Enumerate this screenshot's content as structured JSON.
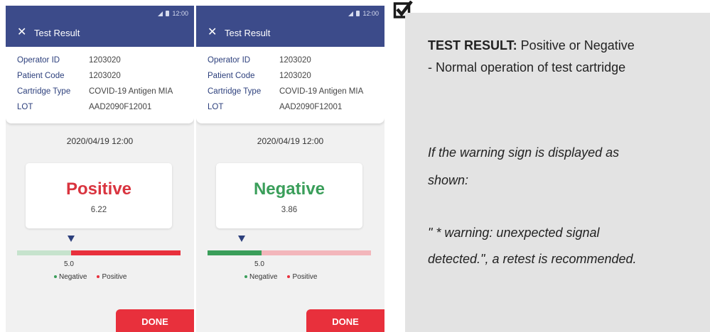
{
  "colors": {
    "appbar": "#3c4b8a",
    "positive_red": "#d9343f",
    "negative_green": "#3a9e5a",
    "done_button": "#e8303c",
    "bar_light_green": "#c6e3cd",
    "bar_light_red": "#f3b6bb"
  },
  "screens": [
    {
      "status_time": "12:00",
      "title": "Test Result",
      "fields": [
        {
          "label": "Operator ID",
          "value": "1203020"
        },
        {
          "label": "Patient Code",
          "value": "1203020"
        },
        {
          "label": "Cartridge Type",
          "value": "COVID-19 Antigen MIA"
        },
        {
          "label": "LOT",
          "value": "AAD2090F12001"
        }
      ],
      "date": "2020/04/19 12:00",
      "result_label": "Positive",
      "result_value": "6.22",
      "threshold_label": "5.0",
      "legend": {
        "negative": "Negative",
        "positive": "Positive"
      },
      "done_label": "DONE"
    },
    {
      "status_time": "12:00",
      "title": "Test Result",
      "fields": [
        {
          "label": "Operator ID",
          "value": "1203020"
        },
        {
          "label": "Patient Code",
          "value": "1203020"
        },
        {
          "label": "Cartridge Type",
          "value": "COVID-19 Antigen MIA"
        },
        {
          "label": "LOT",
          "value": "AAD2090F12001"
        }
      ],
      "date": "2020/04/19 12:00",
      "result_label": "Negative",
      "result_value": "3.86",
      "threshold_label": "5.0",
      "legend": {
        "negative": "Negative",
        "positive": "Positive"
      },
      "done_label": "DONE"
    }
  ],
  "panel": {
    "line1_bold": "TEST RESULT:",
    "line1_rest": " Positive or Negative",
    "line2": "- Normal operation of test cartridge",
    "warning_intro_1": "If the warning sign is displayed as",
    "warning_intro_2": "shown:",
    "warning_msg_1": "\" * warning: unexpected signal",
    "warning_msg_2": "detected.\", a retest is recommended."
  }
}
